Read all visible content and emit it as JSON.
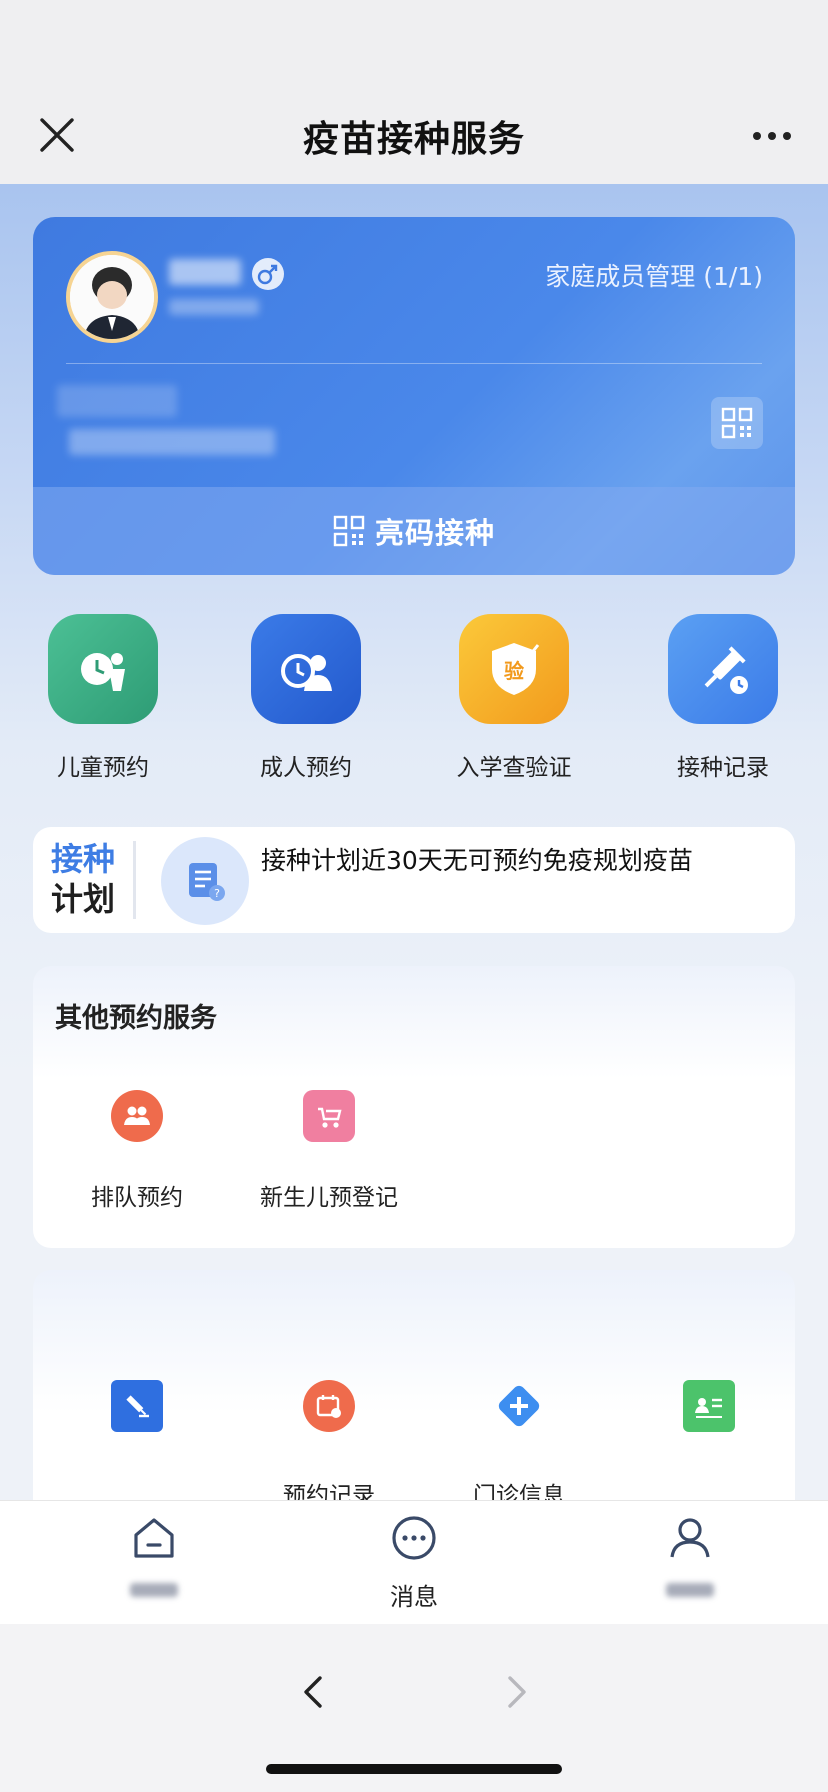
{
  "nav": {
    "title": "疫苗接种服务",
    "close_icon": "close-icon",
    "more_icon": "more-icon"
  },
  "profile": {
    "family_manage_label": "家庭成员管理 (1/1)",
    "show_code_label": "亮码接种",
    "gender_icon": "male-icon",
    "accent_color": "#4a88ea"
  },
  "quick_entries": [
    {
      "label": "儿童预约",
      "icon": "child-appointment-icon",
      "color": "#3bb086"
    },
    {
      "label": "成人预约",
      "icon": "adult-appointment-icon",
      "color": "#2f6fe0"
    },
    {
      "label": "入学查验证",
      "icon": "school-verification-icon",
      "color": "#f5a623"
    },
    {
      "label": "接种记录",
      "icon": "vaccination-record-icon",
      "color": "#3d86ef"
    }
  ],
  "plan": {
    "tag_line1": "接种",
    "tag_line2": "计划",
    "text": "接种计划近30天无可预约免疫规划疫苗"
  },
  "other_services": {
    "title": "其他预约服务",
    "items": [
      {
        "label": "排队预约",
        "icon": "queue-icon",
        "color": "#ef6b4c"
      },
      {
        "label": "新生儿预登记",
        "icon": "stroller-icon",
        "color": "#f07fa0"
      }
    ]
  },
  "tools": {
    "items": [
      {
        "label": "",
        "icon": "vaccine-document-icon",
        "color": "#2f6fe0"
      },
      {
        "label": "预约记录",
        "icon": "calendar-icon",
        "color": "#ef6b4c"
      },
      {
        "label": "门诊信息",
        "icon": "clinic-plus-icon",
        "color": "#3d8ef0"
      },
      {
        "label": "",
        "icon": "id-card-icon",
        "color": "#4cc36b"
      }
    ]
  },
  "tab_bar": {
    "items": [
      {
        "label": "",
        "icon": "home-icon"
      },
      {
        "label": "消息",
        "icon": "message-icon"
      },
      {
        "label": "",
        "icon": "profile-icon"
      }
    ]
  },
  "browser": {
    "back_icon": "back-icon",
    "forward_icon": "forward-icon"
  }
}
